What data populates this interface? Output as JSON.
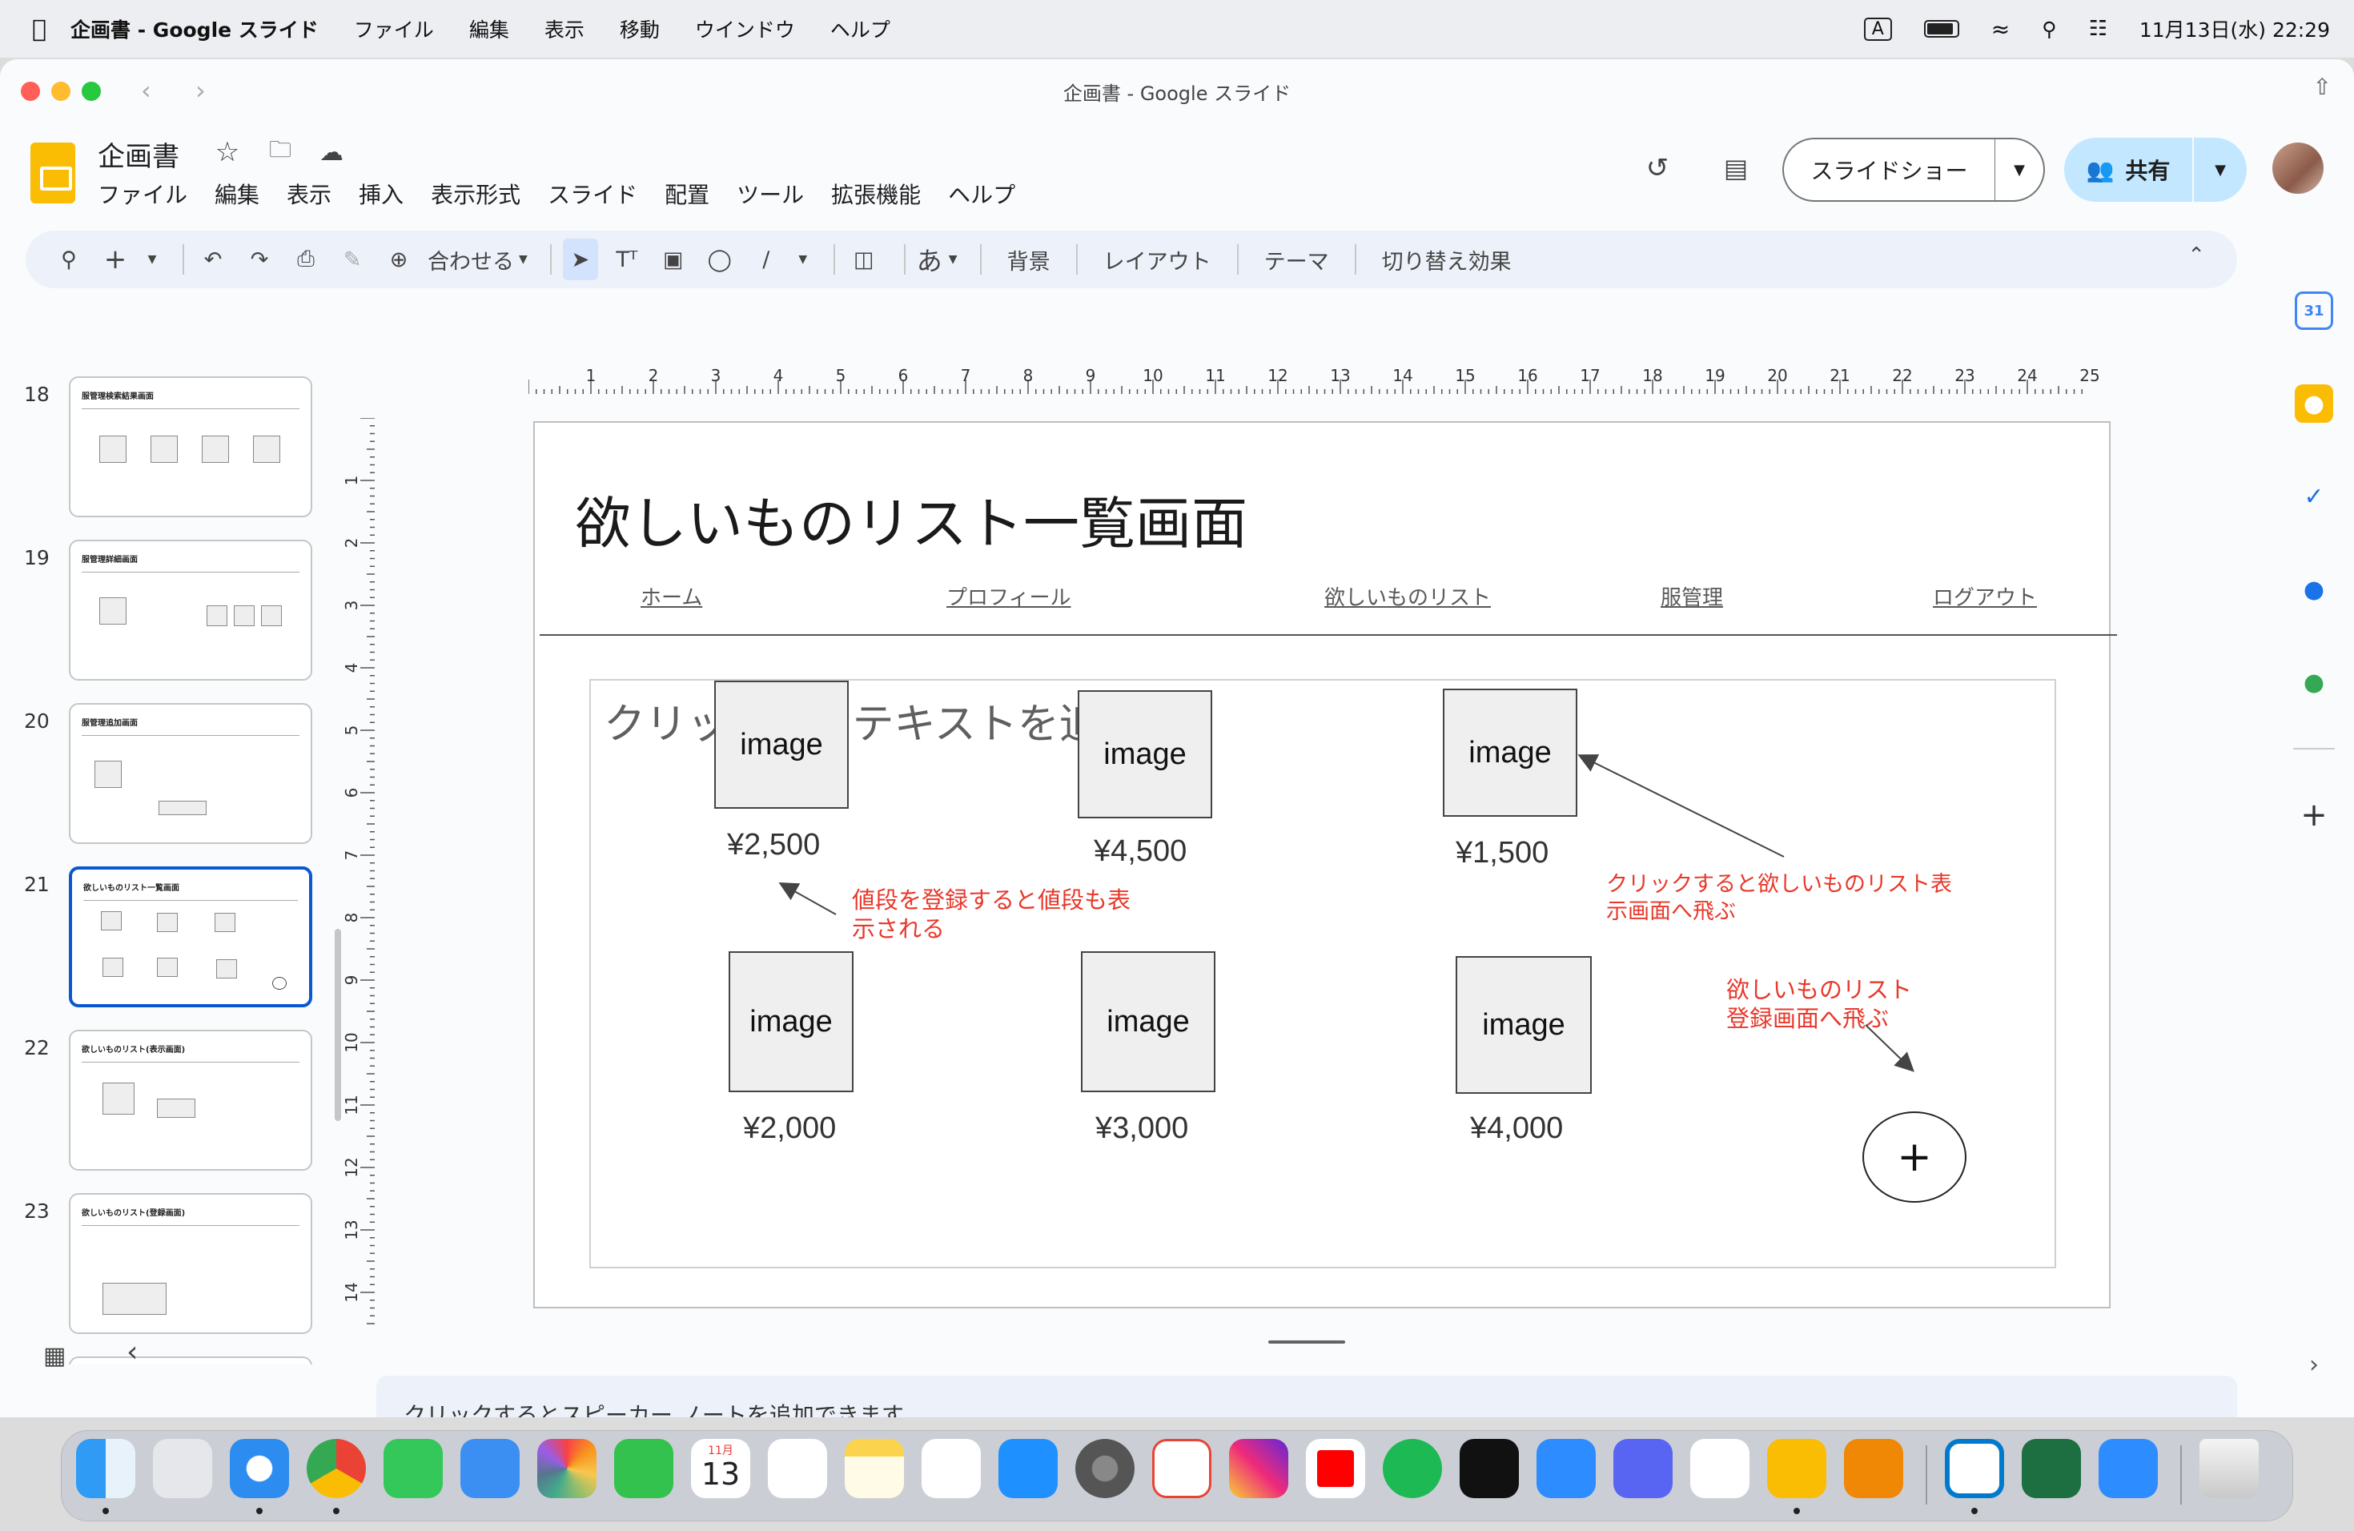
{
  "menubar": {
    "app_name": "企画書 - Google スライド",
    "items": [
      "ファイル",
      "編集",
      "表示",
      "移動",
      "ウインドウ",
      "ヘルプ"
    ],
    "input_indicator": "A",
    "datetime": "11月13日(水)  22:29"
  },
  "window": {
    "title": "企画書 - Google スライド"
  },
  "doc": {
    "title": "企画書",
    "menus": [
      "ファイル",
      "編集",
      "表示",
      "挿入",
      "表示形式",
      "スライド",
      "配置",
      "ツール",
      "拡張機能",
      "ヘルプ"
    ],
    "slideshow_label": "スライドショー",
    "share_label": "共有"
  },
  "toolbar": {
    "zoom_label": "合わせる",
    "kana_label": "あ",
    "background_label": "背景",
    "layout_label": "レイアウト",
    "theme_label": "テーマ",
    "transition_label": "切り替え効果"
  },
  "filmstrip": {
    "slides": [
      {
        "number": "18",
        "title": "服管理検索結果画面",
        "selected": false
      },
      {
        "number": "19",
        "title": "服管理詳細画面",
        "selected": false
      },
      {
        "number": "20",
        "title": "服管理追加画面",
        "selected": false
      },
      {
        "number": "21",
        "title": "欲しいものリスト一覧画面",
        "selected": true
      },
      {
        "number": "22",
        "title": "欲しいものリスト(表示画面)",
        "selected": false
      },
      {
        "number": "23",
        "title": "欲しいものリスト(登録画面)",
        "selected": false
      }
    ]
  },
  "ruler": {
    "top": [
      "1",
      "2",
      "3",
      "4",
      "5",
      "6",
      "7",
      "8",
      "9",
      "10",
      "11",
      "12",
      "13",
      "14",
      "15",
      "16",
      "17",
      "18",
      "19",
      "20",
      "21",
      "22",
      "23",
      "24",
      "25"
    ],
    "left": [
      "1",
      "2",
      "3",
      "4",
      "5",
      "6",
      "7",
      "8",
      "9",
      "10",
      "11",
      "12",
      "13",
      "14"
    ]
  },
  "slide": {
    "title": "欲しいものリスト一覧画面",
    "nav": [
      "ホーム",
      "プロフィール",
      "欲しいものリスト",
      "服管理",
      "ログアウト"
    ],
    "placeholder": "クリックしてテキストを追加",
    "items": [
      {
        "label": "image",
        "price": "¥2,500"
      },
      {
        "label": "image",
        "price": "¥4,500"
      },
      {
        "label": "image",
        "price": "¥1,500"
      },
      {
        "label": "image",
        "price": "¥2,000"
      },
      {
        "label": "image",
        "price": "¥3,000"
      },
      {
        "label": "image",
        "price": "¥4,000"
      }
    ],
    "note_price": "値段を登録すると値段も表\n示される",
    "note_click": "クリックすると欲しいものリスト表\n示画面へ飛ぶ",
    "note_register": "欲しいものリスト\n登録画面へ飛ぶ",
    "plus_label": "+"
  },
  "speaker_notes_placeholder": "クリックするとスピーカー ノートを追加できます",
  "dock": {
    "calendar_month": "11月",
    "calendar_day": "13"
  },
  "colors": {
    "accent": "#0b57d0",
    "share_bg": "#c2e7ff",
    "annotation_red": "#e8382b",
    "slides_yellow": "#fbbc04"
  }
}
